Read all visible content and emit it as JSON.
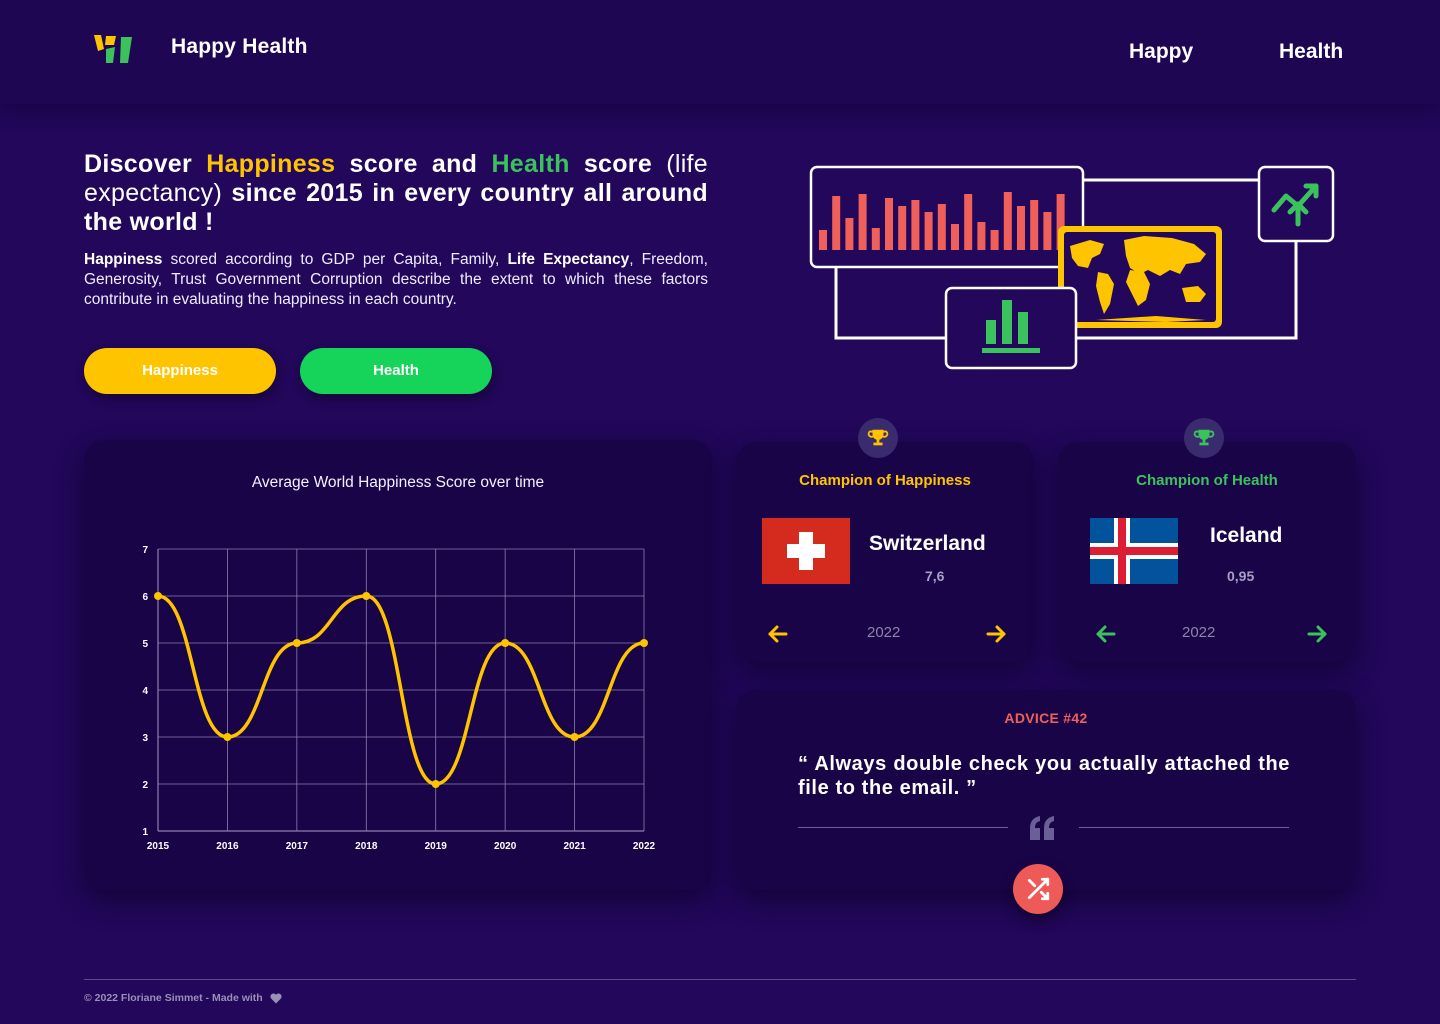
{
  "header": {
    "brand": "Happy Health",
    "nav": [
      {
        "label": "Happy"
      },
      {
        "label": "Health"
      }
    ]
  },
  "hero": {
    "title_parts": {
      "p1": "Discover ",
      "happiness": "Happiness",
      "p2": " score and ",
      "health": "Health",
      "p3": " score ",
      "p4": "(life expectancy)",
      "p5": " since 2015 in every country all around the world !"
    },
    "desc_parts": {
      "b1": "Happiness",
      "t1": " scored according to GDP per Capita, Family, ",
      "b2": "Life Expectancy",
      "t2": ", Freedom, Generosity, Trust Government Corruption describe the extent to which these factors contribute in evaluating the happiness in each country."
    },
    "buttons": {
      "happiness": "Happiness",
      "health": "Health"
    }
  },
  "chart_data": {
    "type": "line",
    "title": "Average World Happiness Score over time",
    "x": [
      "2015",
      "2016",
      "2017",
      "2018",
      "2019",
      "2020",
      "2021",
      "2022"
    ],
    "series": [
      {
        "values": [
          6,
          3,
          5,
          6,
          2,
          5,
          3,
          5
        ]
      }
    ],
    "ylim": [
      1,
      7
    ],
    "yticks": [
      "1",
      "2",
      "3",
      "4",
      "5",
      "6",
      "7"
    ],
    "grid": true,
    "color": "#ffc400"
  },
  "champions": {
    "happiness": {
      "label": "Champion of Happiness",
      "country": "Switzerland",
      "score": "7,6",
      "year": "2022",
      "color": "#ffc400"
    },
    "health": {
      "label": "Champion of Health",
      "country": "Iceland",
      "score": "0,95",
      "year": "2022",
      "color": "#3cc25c"
    }
  },
  "advice": {
    "label": "ADVICE #42",
    "quote": "“ Always double check you actually attached the file to the email. ”"
  },
  "footer": {
    "text": "© 2022 Floriane Simmet - Made with"
  },
  "colors": {
    "background": "#22075a",
    "card": "#1a0448",
    "happiness": "#ffc400",
    "health": "#16d45a",
    "advice": "#ee5a57"
  }
}
